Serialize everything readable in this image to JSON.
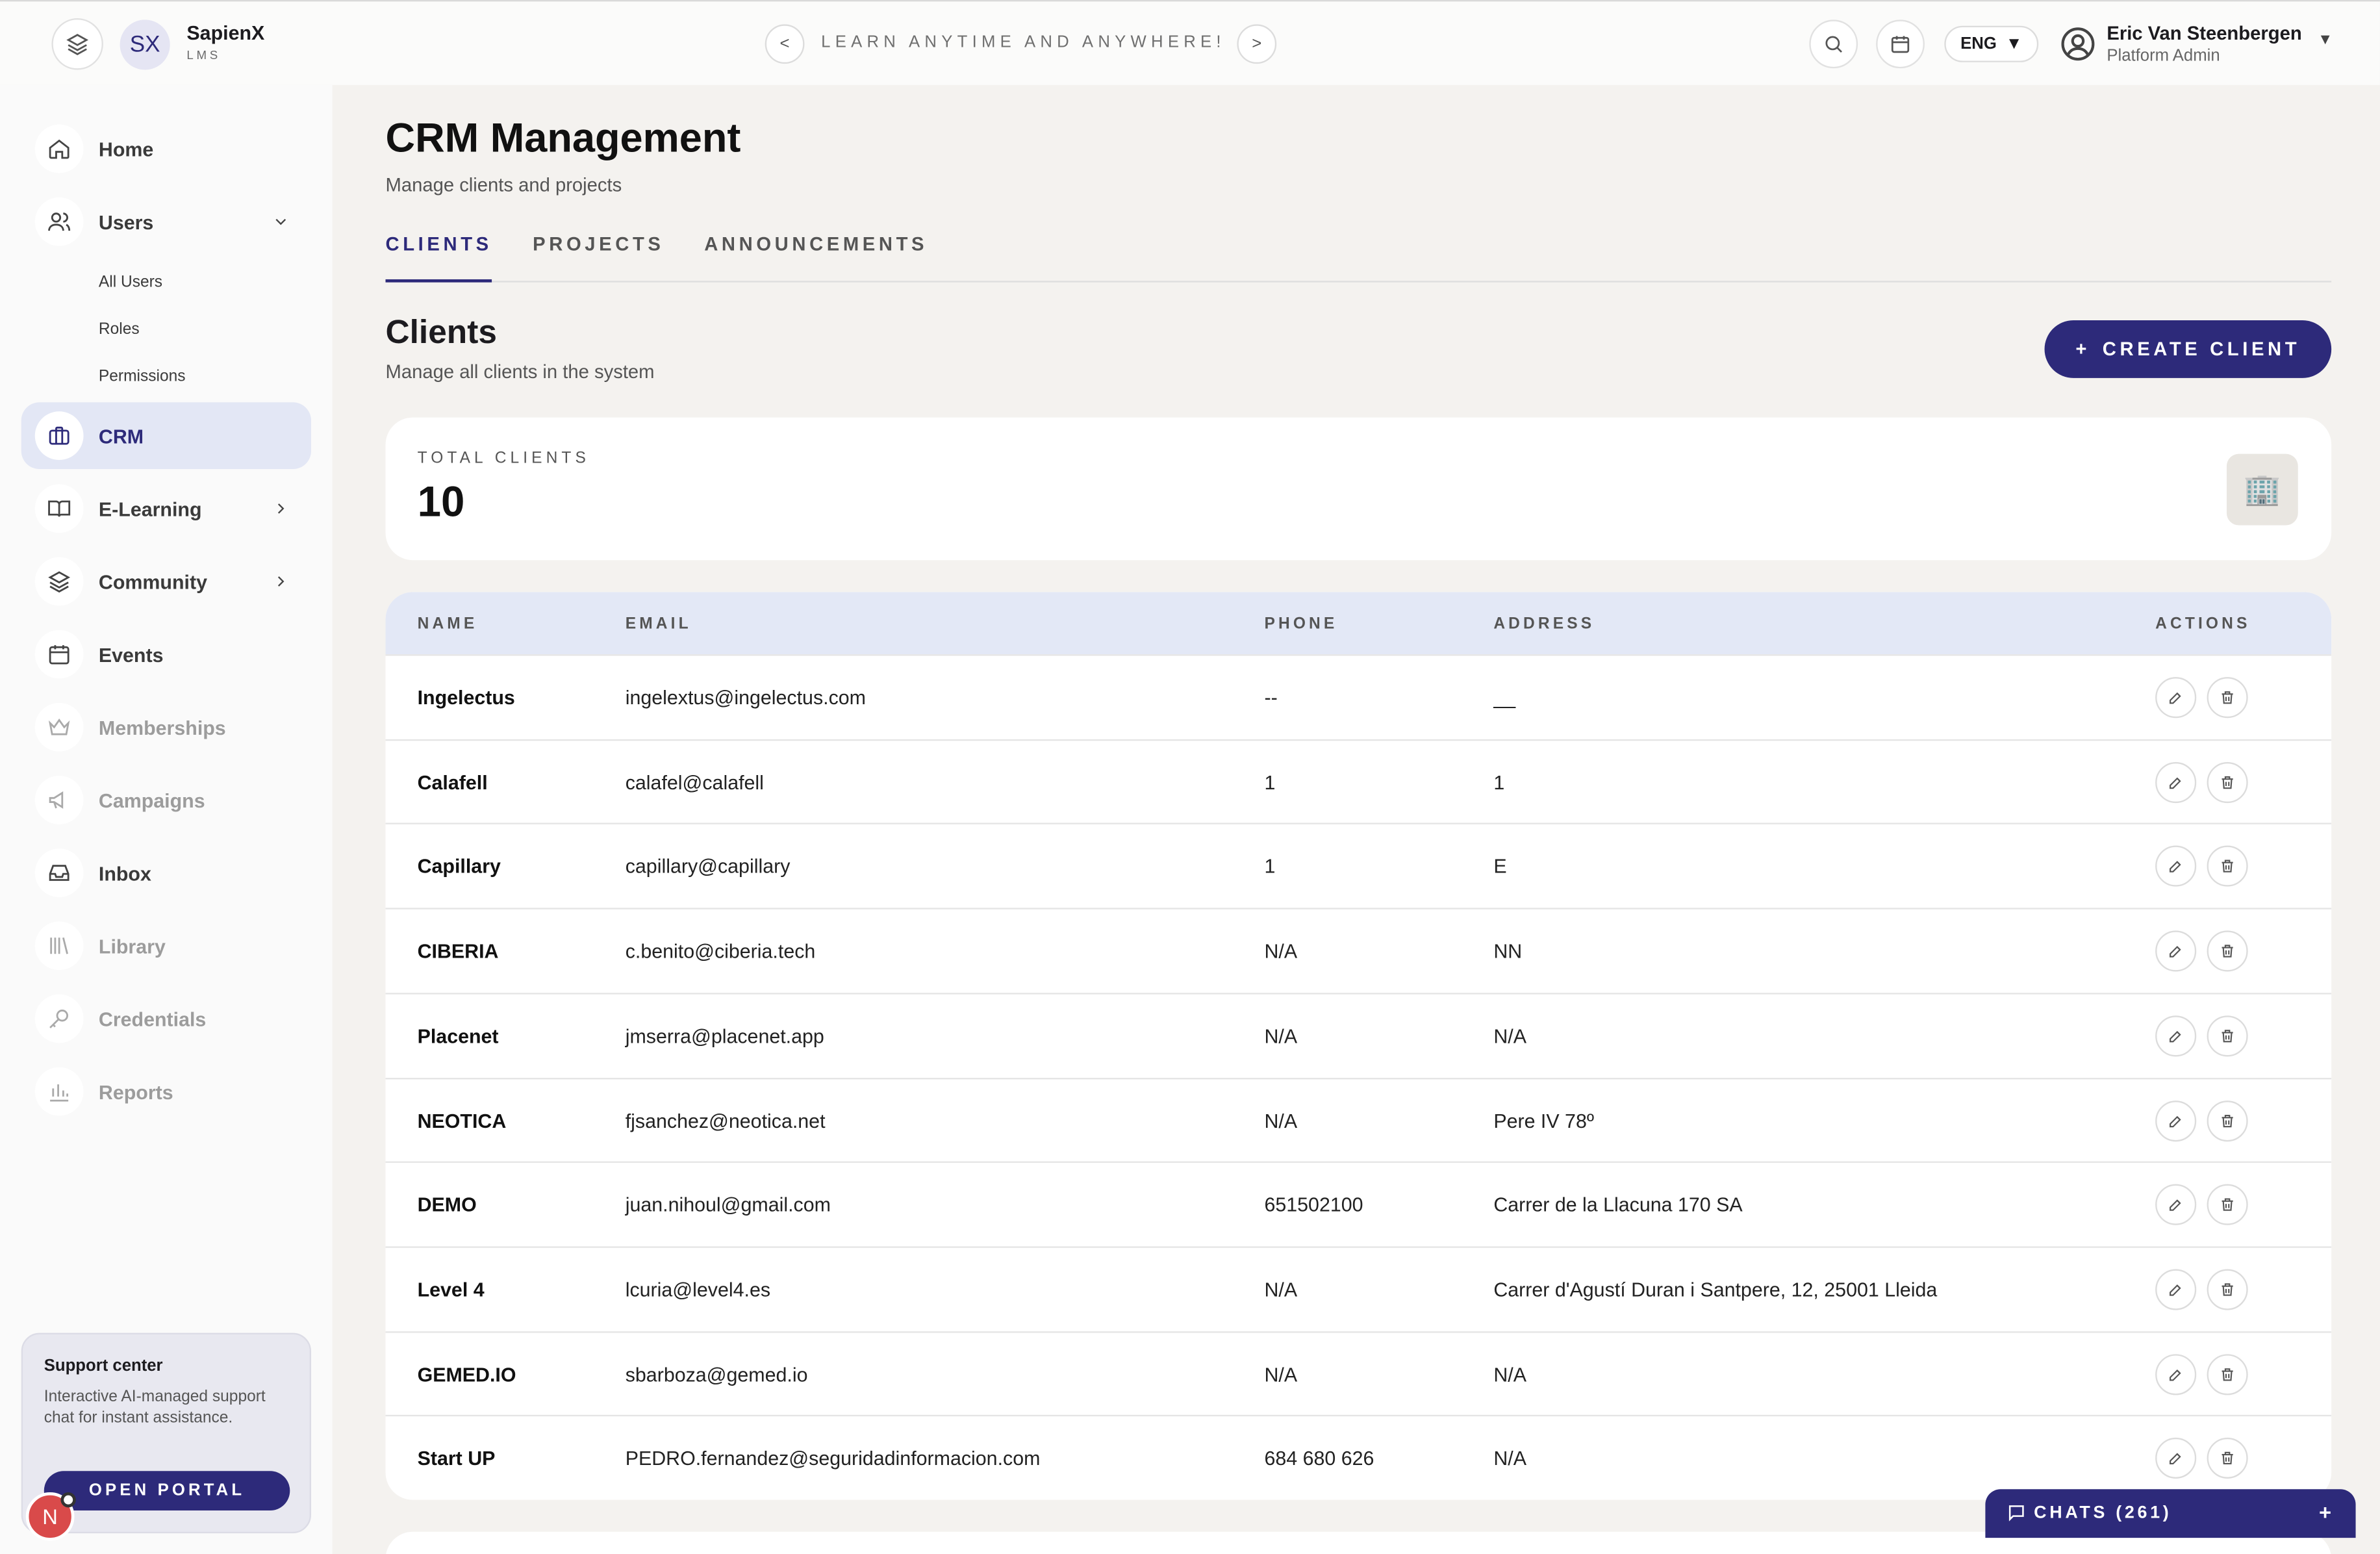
{
  "header": {
    "brand_initials": "SX",
    "brand_name": "SapienX",
    "brand_sub": "LMS",
    "prev": "<",
    "next": ">",
    "tagline": "LEARN ANYTIME AND ANYWHERE!",
    "language": "ENG",
    "user_name": "Eric Van Steenbergen",
    "user_role": "Platform Admin"
  },
  "sidebar": {
    "items": [
      {
        "label": "Home",
        "icon": "home-icon",
        "muted": false
      },
      {
        "label": "Users",
        "icon": "users-icon",
        "muted": false,
        "expanded": true
      },
      {
        "label": "CRM",
        "icon": "briefcase-icon",
        "muted": false,
        "active": true
      },
      {
        "label": "E-Learning",
        "icon": "book-icon",
        "muted": false
      },
      {
        "label": "Community",
        "icon": "layers-icon",
        "muted": false
      },
      {
        "label": "Events",
        "icon": "calendar-icon",
        "muted": false
      },
      {
        "label": "Memberships",
        "icon": "crown-icon",
        "muted": true
      },
      {
        "label": "Campaigns",
        "icon": "megaphone-icon",
        "muted": true
      },
      {
        "label": "Inbox",
        "icon": "inbox-icon",
        "muted": false
      },
      {
        "label": "Library",
        "icon": "library-icon",
        "muted": true
      },
      {
        "label": "Credentials",
        "icon": "key-icon",
        "muted": true
      },
      {
        "label": "Reports",
        "icon": "bar-chart-icon",
        "muted": true
      }
    ],
    "users_sub": [
      "All Users",
      "Roles",
      "Permissions"
    ],
    "support": {
      "title": "Support center",
      "text": "Interactive AI-managed support chat for instant assistance.",
      "button": "OPEN PORTAL"
    },
    "fab": "N"
  },
  "main": {
    "title": "CRM Management",
    "subtitle": "Manage clients and projects",
    "tabs": [
      "CLIENTS",
      "PROJECTS",
      "ANNOUNCEMENTS"
    ],
    "active_tab": "CLIENTS",
    "section_title": "Clients",
    "section_sub": "Manage all clients in the system",
    "create_button": "CREATE CLIENT",
    "create_plus": "+",
    "stat_label": "TOTAL CLIENTS",
    "stat_value": "10",
    "stat_icon": "🏢",
    "table": {
      "headers": [
        "NAME",
        "EMAIL",
        "PHONE",
        "ADDRESS",
        "ACTIONS"
      ],
      "rows": [
        {
          "name": "Ingelectus",
          "email": "ingelextus@ingelectus.com",
          "phone": "--",
          "address": "__"
        },
        {
          "name": "Calafell",
          "email": "calafel@calafell",
          "phone": "1",
          "address": "1"
        },
        {
          "name": "Capillary",
          "email": "capillary@capillary",
          "phone": "1",
          "address": "E"
        },
        {
          "name": "CIBERIA",
          "email": "c.benito@ciberia.tech",
          "phone": "N/A",
          "address": "NN"
        },
        {
          "name": "Placenet",
          "email": "jmserra@placenet.app",
          "phone": "N/A",
          "address": "N/A"
        },
        {
          "name": "NEOTICA",
          "email": "fjsanchez@neotica.net",
          "phone": "N/A",
          "address": "Pere IV 78º"
        },
        {
          "name": "DEMO",
          "email": "juan.nihoul@gmail.com",
          "phone": "651502100",
          "address": "Carrer de la Llacuna 170 SA"
        },
        {
          "name": "Level 4",
          "email": "lcuria@level4.es",
          "phone": "N/A",
          "address": "Carrer d'Agustí Duran i Santpere, 12, 25001 Lleida"
        },
        {
          "name": "GEMED.IO",
          "email": "sbarboza@gemed.io",
          "phone": "N/A",
          "address": "N/A"
        },
        {
          "name": "Start UP",
          "email": "PEDRO.fernandez@seguridadinformacion.com",
          "phone": "684 680 626",
          "address": "N/A"
        }
      ]
    }
  },
  "chats": {
    "label": "CHATS (261)",
    "plus": "+"
  },
  "colors": {
    "accent": "#2d2a7a",
    "active_bg": "#e3e7f5",
    "table_head_bg": "#e3e8f6",
    "page_bg": "#f4f2ef"
  }
}
